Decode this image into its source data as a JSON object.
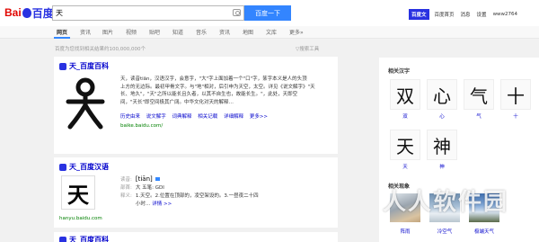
{
  "logo": {
    "bai": "Bai",
    "du": "百度"
  },
  "search": {
    "value": "天",
    "button": "百度一下"
  },
  "topbar": {
    "baijia": "百度文",
    "links": [
      "百度首页",
      "消息",
      "设置"
    ],
    "user": "www2764"
  },
  "tabs": [
    {
      "label": "网页",
      "active": true
    },
    {
      "label": "资讯"
    },
    {
      "label": "图片"
    },
    {
      "label": "视频"
    },
    {
      "label": "贴吧"
    },
    {
      "label": "知道"
    },
    {
      "label": "音乐"
    },
    {
      "label": "资讯"
    },
    {
      "label": "地图"
    },
    {
      "label": "文库"
    },
    {
      "label": "更多»"
    }
  ],
  "stats": "百度为您找到相关结果约100,000,000个",
  "tools": "▽搜索工具",
  "baike": {
    "title": "天_百度百科",
    "text_lines": [
      "天，读音tiān，汉语汉字，会意字，\"大\"字上面加着一个\"口\"字，篆字本义是人的头顶",
      "上方的无边际。最初甲骨文字。与\"地\"相对，后引申为天空，太空。详见《说文解字》\"天",
      "长、地久\"，\"天\"之所以能长且久者，以其不自生也，故能长生。\"，此处，天即空",
      "间，\"天长\"即空间极其广阔。中华文化对天的解释…"
    ],
    "links": [
      "历史由来",
      "说文解字",
      "词典解释",
      "相关记载",
      "详细解释",
      "更多>>"
    ],
    "url": "baike.baidu.com/"
  },
  "hanyu": {
    "title": "天_百度汉语",
    "char": "天",
    "pinyin_label": "读音:",
    "pinyin": "[tiān]",
    "radical_label": "部首:",
    "radical": "大  五笔:  GDI",
    "meaning_label": "释义:",
    "meaning": "1.天空。2.位置在顶部的，凌空架设的。3.一昼夜二十四",
    "meaning2": "小时…",
    "detail": "详情 >>",
    "url": "hanyu.baidu.com"
  },
  "third": {
    "title": "天_百度百科"
  },
  "related": {
    "title": "相关汉字",
    "chars": [
      {
        "char": "双",
        "label": "双"
      },
      {
        "char": "心",
        "label": "心"
      },
      {
        "char": "气",
        "label": "气"
      },
      {
        "char": "十",
        "label": "十"
      },
      {
        "char": "天",
        "label": "天"
      },
      {
        "char": "神",
        "label": "神"
      }
    ]
  },
  "phenomena": {
    "title": "相关现象",
    "items": [
      {
        "label": "阵雨"
      },
      {
        "label": "冷空气"
      },
      {
        "label": "极端天气"
      }
    ]
  },
  "watermark": "人人软件园"
}
